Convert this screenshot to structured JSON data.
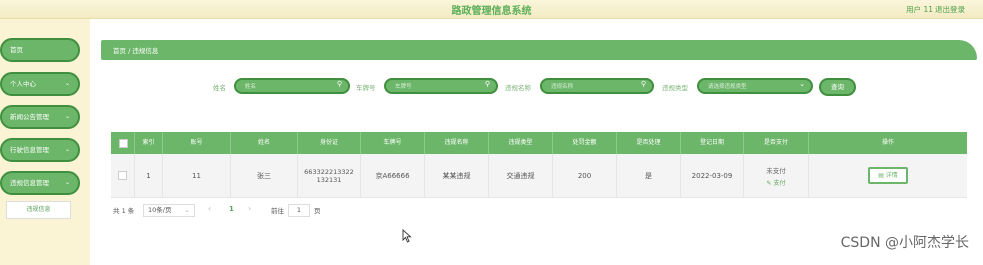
{
  "header": {
    "title": "路政管理信息系统",
    "user": "用户 11",
    "logout": "退出登录"
  },
  "sidebar": {
    "items": [
      {
        "label": "首页",
        "chevron": ""
      },
      {
        "label": "个人中心",
        "chevron": "⌄"
      },
      {
        "label": "新闻公告管理",
        "chevron": "⌄"
      },
      {
        "label": "行驶信息管理",
        "chevron": "⌄"
      },
      {
        "label": "违规信息管理",
        "chevron": "⌄"
      }
    ],
    "submenu_active": "违规信息"
  },
  "breadcrumb": "首页 / 违规信息",
  "search": {
    "fields": [
      {
        "label": "姓名",
        "placeholder": "姓名"
      },
      {
        "label": "车牌号",
        "placeholder": "车牌号"
      },
      {
        "label": "违规名称",
        "placeholder": "违规名称"
      },
      {
        "label": "违规类型",
        "placeholder": "请选择违规类型"
      }
    ],
    "query_label": "查询",
    "search_icon": "magnifier-icon",
    "select_icon": "chevron-down-icon"
  },
  "table": {
    "headers": [
      "索引",
      "账号",
      "姓名",
      "身份证",
      "车牌号",
      "违规名称",
      "违规类型",
      "处罚金额",
      "是否处理",
      "登记日期",
      "是否支付",
      "操作"
    ],
    "row": {
      "index": "1",
      "account": "11",
      "name": "张三",
      "id_card_line1": "663322213322",
      "id_card_line2": "132131",
      "plate": "京A66666",
      "violation_name": "某某违规",
      "violation_type": "交通违规",
      "fine": "200",
      "handled": "是",
      "date": "2022-03-09",
      "paid_status": "未支付",
      "pay_link": "支付",
      "detail_btn": "详情"
    }
  },
  "pagination": {
    "total": "共 1 条",
    "page_size": "10条/页",
    "current_page": "1",
    "goto_label": "前往",
    "goto_value": "1",
    "page_suffix": "页"
  },
  "watermark": "CSDN @小阿杰学长",
  "colors": {
    "accent": "#6cb66a",
    "accent_dark": "#3f8f3e",
    "header_bg": "#f3ebc2",
    "sidebar_bg": "#fbf4d4"
  }
}
